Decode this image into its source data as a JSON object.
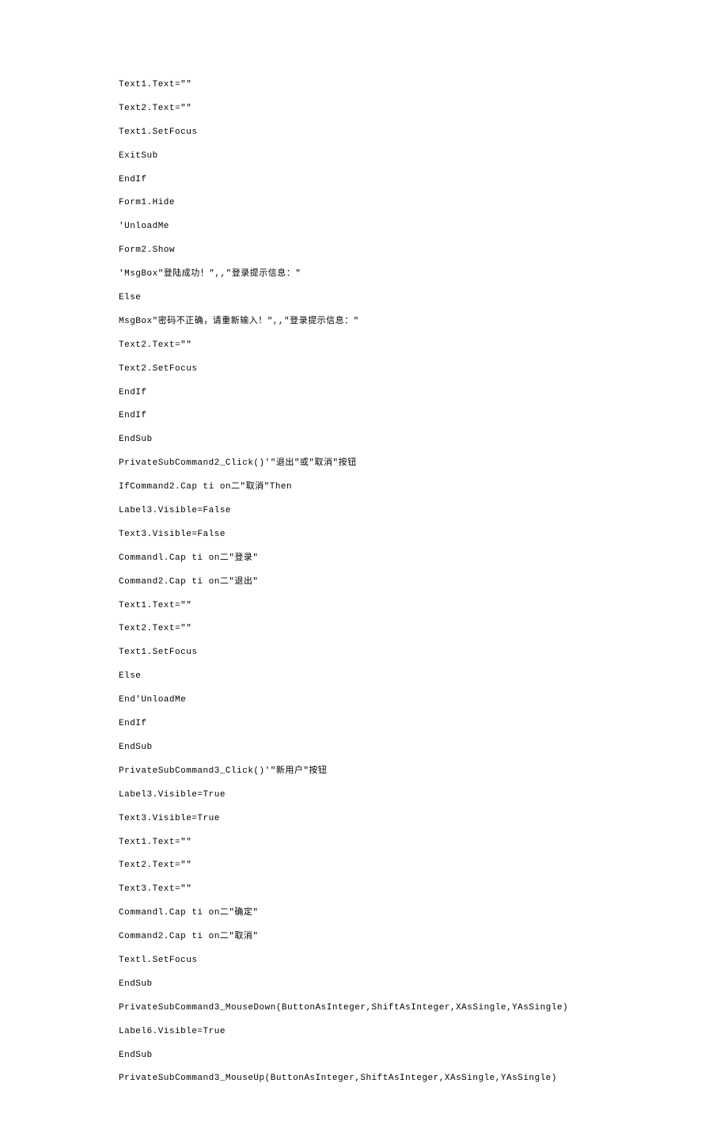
{
  "lines": [
    "Text1.Text=\"\"",
    "Text2.Text=\"\"",
    "Text1.SetFocus",
    "ExitSub",
    "EndIf",
    "Form1.Hide",
    "'UnloadMe",
    "Form2.Show",
    "'MsgBox\"登陆成功！\",,\"登录提示信息：\"",
    "Else",
    "MsgBox\"密码不正确，请重新输入！\",,\"登录提示信息：\"",
    "Text2.Text=\"\"",
    "Text2.SetFocus",
    "EndIf",
    "EndIf",
    "EndSub",
    "PrivateSubCommand2_Click()'\"退出\"或\"取消\"按钮",
    "IfCommand2.Cap ti on二\"取消\"Then",
    "Label3.Visible=False",
    "Text3.Visible=False",
    "Commandl.Cap ti on二\"登录\"",
    "Command2.Cap ti on二\"退出\"",
    "Text1.Text=\"\"",
    "Text2.Text=\"\"",
    "Text1.SetFocus",
    "Else",
    "End'UnloadMe",
    "EndIf",
    "EndSub",
    "PrivateSubCommand3_Click()'\"新用户\"按钮",
    "Label3.Visible=True",
    "Text3.Visible=True",
    "Text1.Text=\"\"",
    "Text2.Text=\"\"",
    "Text3.Text=\"\"",
    "Commandl.Cap ti on二\"确定\"",
    "Command2.Cap ti on二\"取消\"",
    "Textl.SetFocus",
    "EndSub",
    "PrivateSubCommand3_MouseDown(ButtonAsInteger,ShiftAsInteger,XAsSingle,YAsSingle)",
    "Label6.Visible=True",
    "EndSub",
    "PrivateSubCommand3_MouseUp(ButtonAsInteger,ShiftAsInteger,XAsSingle,YAsSingle)"
  ]
}
